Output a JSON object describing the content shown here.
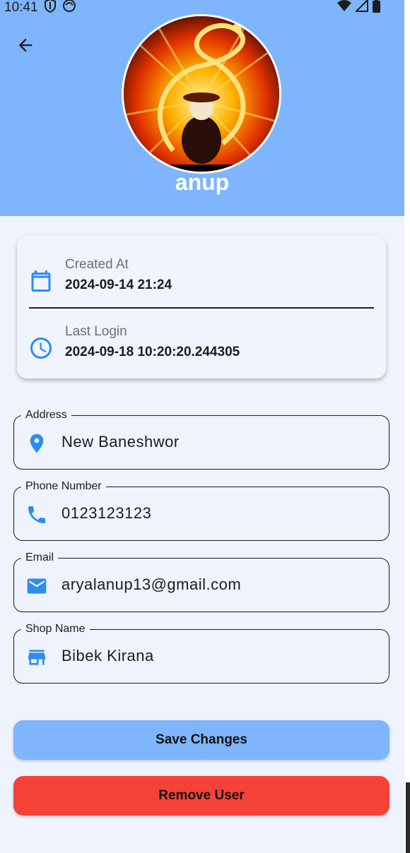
{
  "status_bar": {
    "time": "10:41"
  },
  "profile": {
    "name": "anup"
  },
  "info": {
    "created_label": "Created At",
    "created_value": "2024-09-14 21:24",
    "login_label": "Last Login",
    "login_value": "2024-09-18 10:20:20.244305"
  },
  "fields": {
    "address": {
      "label": "Address",
      "value": "New Baneshwor"
    },
    "phone": {
      "label": "Phone Number",
      "value": "0123123123"
    },
    "email": {
      "label": "Email",
      "value": "aryalanup13@gmail.com"
    },
    "shop": {
      "label": "Shop Name",
      "value": "Bibek Kirana"
    }
  },
  "buttons": {
    "save": "Save Changes",
    "remove": "Remove User"
  },
  "icons": [
    "back-arrow-icon",
    "calendar-icon",
    "clock-icon",
    "location-pin-icon",
    "phone-icon",
    "email-icon",
    "store-icon",
    "wifi-icon",
    "signal-icon",
    "battery-icon"
  ],
  "colors": {
    "header": "#7eb5fd",
    "background": "#eff3fd",
    "accent": "#2d8cf0",
    "save_button": "#7eb5fd",
    "remove_button": "#f44336"
  }
}
